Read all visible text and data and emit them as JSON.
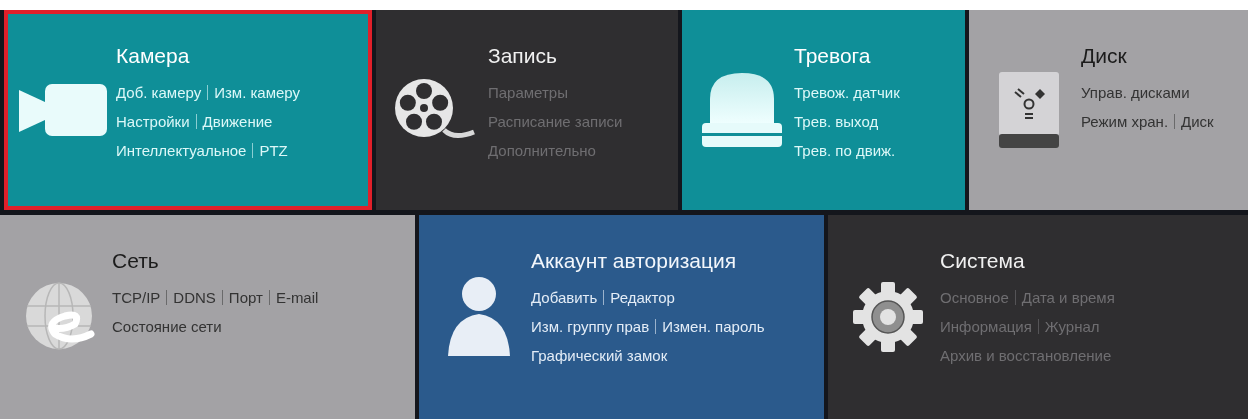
{
  "top_row": [
    {
      "title": "Камера",
      "kind": "camera",
      "selected": true,
      "lines": [
        [
          "Доб. камеру",
          "Изм. камеру"
        ],
        [
          "Настройки",
          "Движение"
        ],
        [
          "Интеллектуальное",
          "PTZ"
        ]
      ]
    },
    {
      "title": "Запись",
      "kind": "recording",
      "selected": false,
      "lines": [
        [
          "Параметры"
        ],
        [
          "Расписание записи"
        ],
        [
          "Дополнительно"
        ]
      ]
    },
    {
      "title": "Тревога",
      "kind": "alarm",
      "selected": false,
      "lines": [
        [
          "Тревож. датчик"
        ],
        [
          "Трев. выход"
        ],
        [
          "Трев. по движ."
        ]
      ]
    },
    {
      "title": "Диск",
      "kind": "disk",
      "selected": false,
      "lines": [
        [
          "Управ. дисками"
        ],
        [
          "Режим хран.",
          "Диск"
        ]
      ]
    }
  ],
  "bottom_row": [
    {
      "title": "Сеть",
      "kind": "network",
      "selected": false,
      "lines": [
        [
          "TCP/IP",
          "DDNS",
          "Порт",
          "E-mail"
        ],
        [
          "Состояние сети"
        ]
      ]
    },
    {
      "title": "Аккаунт авторизация",
      "kind": "account",
      "selected": false,
      "lines": [
        [
          "Добавить",
          "Редактор"
        ],
        [
          "Изм. группу прав",
          "Измен. пароль"
        ],
        [
          "Графический замок"
        ]
      ]
    },
    {
      "title": "Система",
      "kind": "system",
      "selected": false,
      "lines": [
        [
          "Основное",
          "Дата и время"
        ],
        [
          "Информация",
          "Журнал"
        ],
        [
          "Архив и восстановление"
        ]
      ]
    }
  ]
}
